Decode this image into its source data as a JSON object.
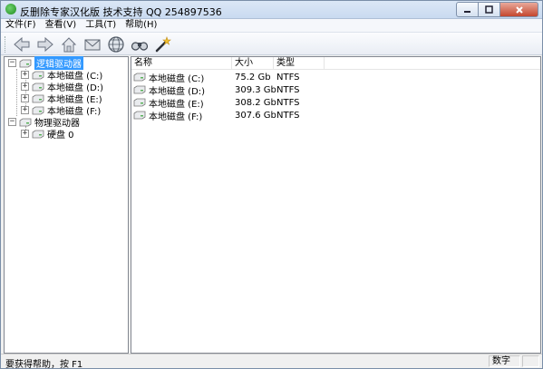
{
  "window": {
    "title": "反删除专家汉化版 技术支持 QQ 254897536",
    "minimize_icon": "minimize-icon",
    "maximize_icon": "maximize-icon",
    "close_icon": "close-icon"
  },
  "menu": [
    {
      "label": "文件(F)"
    },
    {
      "label": "查看(V)"
    },
    {
      "label": "工具(T)"
    },
    {
      "label": "帮助(H)"
    }
  ],
  "toolbar": {
    "icons": [
      "back-arrow-icon",
      "forward-arrow-icon",
      "up-folder-icon",
      "envelope-icon",
      "globe-icon",
      "binoculars-icon",
      "magic-wand-icon"
    ]
  },
  "tree": {
    "logical_root": "逻辑驱动器",
    "logical_children": [
      {
        "label": "本地磁盘 (C:)"
      },
      {
        "label": "本地磁盘 (D:)"
      },
      {
        "label": "本地磁盘 (E:)"
      },
      {
        "label": "本地磁盘 (F:)"
      }
    ],
    "physical_root": "物理驱动器",
    "physical_children": [
      {
        "label": "硬盘 0"
      }
    ]
  },
  "list": {
    "columns": {
      "name": "名称",
      "size": "大小",
      "type": "类型"
    },
    "rows": [
      {
        "name": "本地磁盘 (C:)",
        "size": "75.2 Gb",
        "type": "NTFS"
      },
      {
        "name": "本地磁盘 (D:)",
        "size": "309.3 Gb",
        "type": "NTFS"
      },
      {
        "name": "本地磁盘 (E:)",
        "size": "308.2 Gb",
        "type": "NTFS"
      },
      {
        "name": "本地磁盘 (F:)",
        "size": "307.6 Gb",
        "type": "NTFS"
      }
    ]
  },
  "status": {
    "help_text": "要获得帮助，按 F1",
    "num_lock": "数字"
  }
}
